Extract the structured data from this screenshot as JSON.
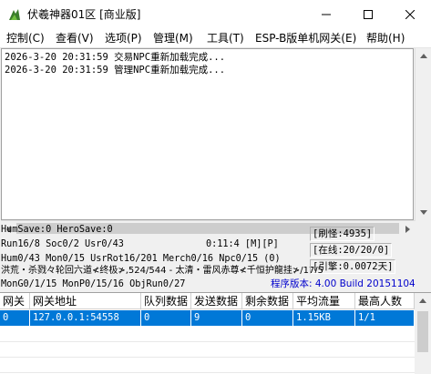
{
  "window": {
    "title": "伏羲神器01区 [商业版]",
    "controls": [
      "minimize",
      "maximize",
      "close"
    ]
  },
  "menu": [
    {
      "label": "控制(C)"
    },
    {
      "label": "查看(V)"
    },
    {
      "label": "选项(P)"
    },
    {
      "label": "管理(M)"
    },
    {
      "label": "工具(T)"
    },
    {
      "label": "ESP-B版单机网关(E)"
    },
    {
      "label": "帮助(H)"
    }
  ],
  "log": [
    "2026-3-20 20:31:59 交易NPC重新加载完成...",
    "2026-3-20 20:31:59 管理NPC重新加载完成..."
  ],
  "status": {
    "line1": "HumSave:0 HeroSave:0",
    "line2": "Run16/8 Soc0/2 Usr0/43",
    "line3": "Hum0/43 Mon0/15 UsrRot16/201 Merch0/16 Npc0/15 (0)",
    "line4": "洪荒・杀戮々轮回六道≮终极≯,524/544 - 太清・雷风赤尊≮千恒护龍挂≯/17/5",
    "line5": "MonG0/1/15 MonP0/15/16 ObjRun0/27",
    "clock": "0:11:4 [M][P]",
    "refresh": "[刷怪:4935]",
    "online": "[在线:20/20/0]",
    "engine": "[引擎:0.0072天]",
    "version": "程序版本: 4.00 Build 20151104"
  },
  "gateway_table": {
    "headers": [
      "网关",
      "网关地址",
      "队列数据",
      "发送数据",
      "剩余数据",
      "平均流量",
      "最高人数"
    ],
    "rows": [
      [
        "0",
        "127.0.0.1:54558",
        "0",
        "9",
        "0",
        "1.15KB",
        "1/1"
      ]
    ]
  },
  "colors": {
    "selection": "#0078d7",
    "version_text": "#0000cc"
  }
}
